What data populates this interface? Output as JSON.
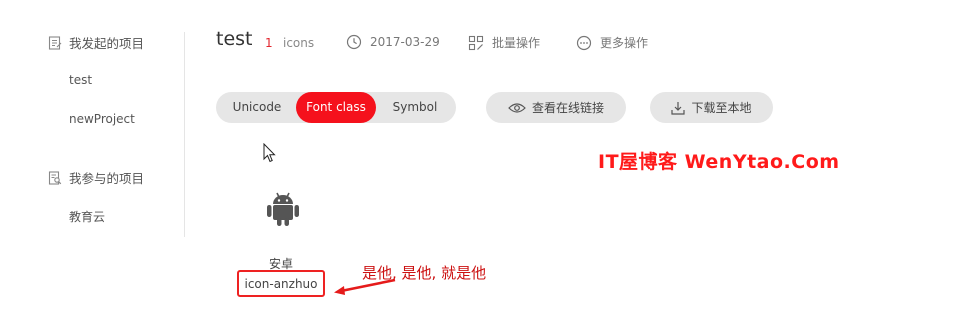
{
  "sidebar": {
    "sections": [
      {
        "label": "我发起的项目",
        "icon": "document-list-icon",
        "items": [
          "test",
          "newProject"
        ]
      },
      {
        "label": "我参与的项目",
        "icon": "document-search-icon",
        "items": [
          "教育云"
        ]
      }
    ]
  },
  "header": {
    "project_title": "test",
    "icon_count": "1",
    "icon_count_unit": "icons",
    "date": "2017-03-29",
    "batch_label": "批量操作",
    "more_label": "更多操作"
  },
  "toolbar": {
    "modes": [
      "Unicode",
      "Font class",
      "Symbol"
    ],
    "active_mode": "Font class",
    "view_link_label": "查看在线链接",
    "download_label": "下载至本地"
  },
  "icon_card": {
    "icon": "android-icon",
    "name": "安卓",
    "class_name": "icon-anzhuo"
  },
  "annotation": "是他, 是他, 就是他",
  "watermark": "IT屋博客  WenYtao.Com",
  "colors": {
    "accent": "#f5111c",
    "annotation": "#cc1111",
    "pill_bg": "#e6e6e6"
  }
}
